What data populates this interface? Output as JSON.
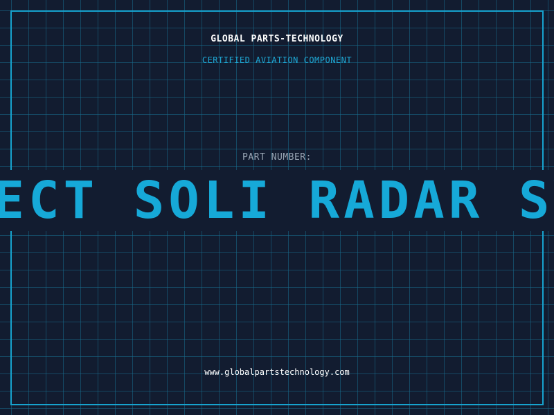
{
  "header": {
    "company": "GLOBAL PARTS-TECHNOLOGY",
    "subtitle": "CERTIFIED AVIATION COMPONENT"
  },
  "part": {
    "label": "PART NUMBER:",
    "value": "JECT SOLI RADAR SYS"
  },
  "footer": {
    "url": "www.globalpartstechnology.com"
  },
  "colors": {
    "background": "#121c30",
    "grid": "#186c8c",
    "accent": "#16a9d8",
    "text": "#ffffff",
    "muted": "#9aa7b6"
  }
}
